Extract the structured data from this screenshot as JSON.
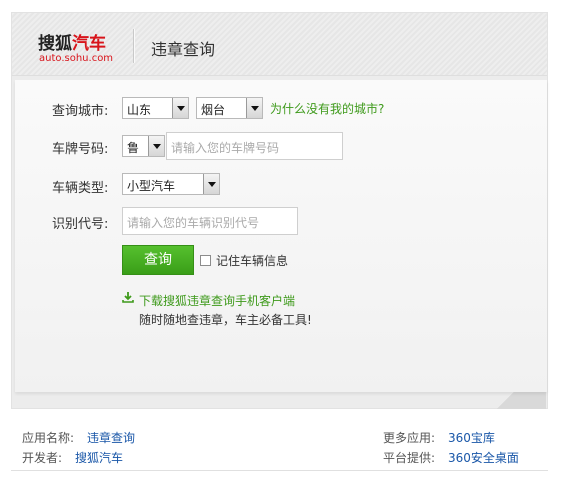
{
  "header": {
    "logo_black": "搜狐",
    "logo_red": "汽车",
    "logo_url": "auto.sohu.com",
    "title": "违章查询"
  },
  "form": {
    "city_label": "查询城市:",
    "province": "山东",
    "city": "烟台",
    "no_city_link": "为什么没有我的城市?",
    "plate_label": "车牌号码:",
    "plate_prefix": "鲁",
    "plate_placeholder": "请输入您的车牌号码",
    "vehicle_type_label": "车辆类型:",
    "vehicle_type": "小型汽车",
    "vin_label": "识别代号:",
    "vin_placeholder": "请输入您的车辆识别代号",
    "query_button": "查询",
    "remember_label": "记住车辆信息",
    "download_link": "下载搜狐违章查询手机客户端",
    "tagline": "随时随地查违章，车主必备工具!"
  },
  "footer": {
    "app_name_label": "应用名称:",
    "app_name": "违章查询",
    "developer_label": "开发者:",
    "developer": "搜狐汽车",
    "more_apps_label": "更多应用:",
    "more_apps": "360宝库",
    "platform_label": "平台提供:",
    "platform": "360安全桌面"
  },
  "colors": {
    "brand_red": "#d8141b",
    "accent_green": "#3e9a1b",
    "link_blue": "#1a57a8"
  }
}
